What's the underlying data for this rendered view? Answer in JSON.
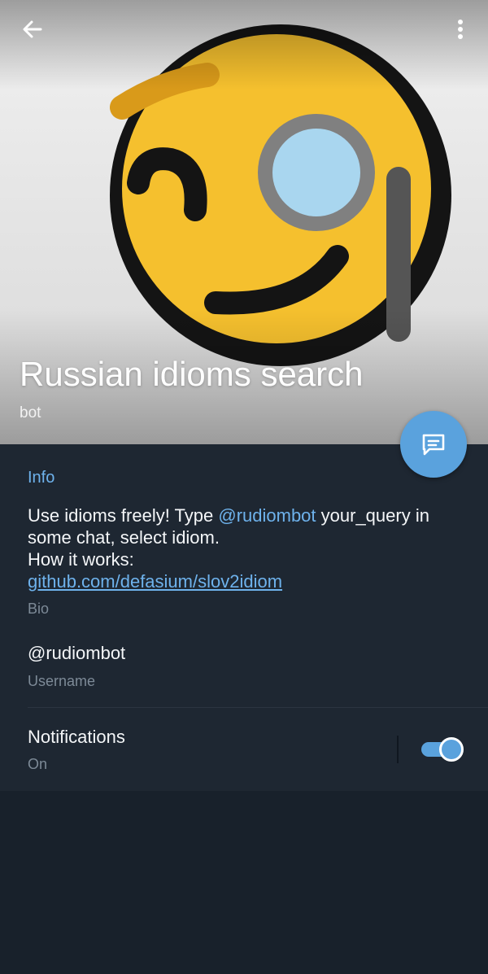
{
  "header": {
    "title": "Russian idioms search",
    "subtitle": "bot",
    "back_icon": "arrow-left-icon",
    "menu_icon": "more-vertical-icon",
    "avatar_icon": "face-with-monocle-emoji"
  },
  "fab": {
    "icon": "message-icon"
  },
  "info": {
    "section_title": "Info",
    "bio": {
      "part1": "Use idioms freely! Type ",
      "mention": "@rudiombot",
      "part2": " your_query in some chat, select idiom.",
      "part3": "How it works:",
      "link": "github.com/defasium/slov2idiom"
    },
    "bio_caption": "Bio",
    "username": "@rudiombot",
    "username_caption": "Username",
    "notifications_label": "Notifications",
    "notifications_value": "On",
    "notifications_enabled": true
  },
  "colors": {
    "accent": "#5aa2dd",
    "link": "#6eb2ec",
    "card_bg": "#1e2732",
    "page_bg": "#18212b",
    "emoji_yellow": "#f5c02e",
    "emoji_outline": "#141414",
    "monocle_ring": "#808080",
    "monocle_lens": "#a9d6ef"
  }
}
